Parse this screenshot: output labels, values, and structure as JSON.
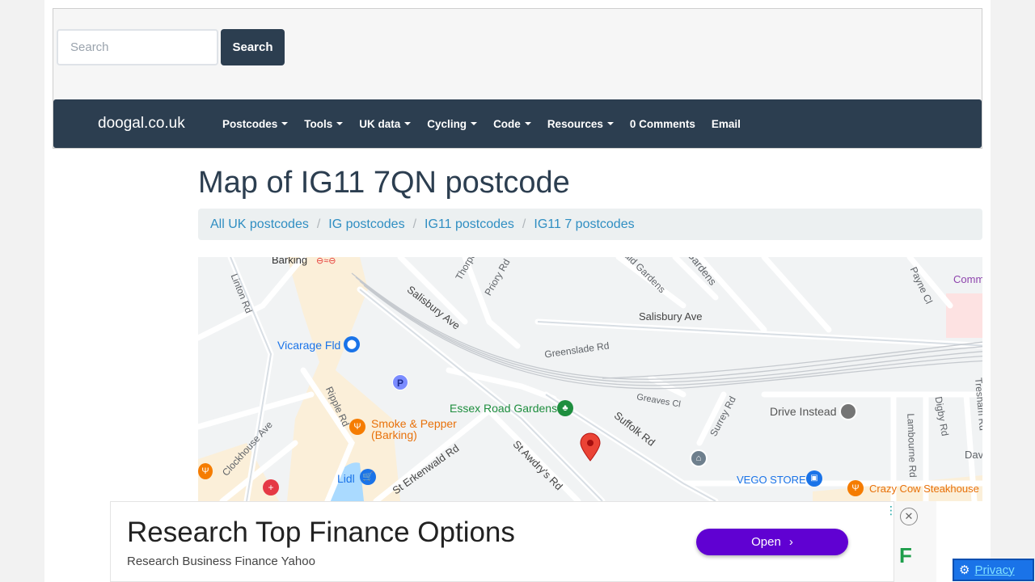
{
  "search": {
    "placeholder": "Search",
    "button_label": "Search"
  },
  "navbar": {
    "brand": "doogal.co.uk",
    "items": [
      {
        "label": "Postcodes",
        "dropdown": true
      },
      {
        "label": "Tools",
        "dropdown": true
      },
      {
        "label": "UK data",
        "dropdown": true
      },
      {
        "label": "Cycling",
        "dropdown": true
      },
      {
        "label": "Code",
        "dropdown": true
      },
      {
        "label": "Resources",
        "dropdown": true
      },
      {
        "label": "0 Comments",
        "dropdown": false
      },
      {
        "label": "Email",
        "dropdown": false
      }
    ]
  },
  "page_title": "Map of IG11 7QN postcode",
  "breadcrumb": [
    "All UK postcodes",
    "IG postcodes",
    "IG11 postcodes",
    "IG11 7 postcodes"
  ],
  "map": {
    "labels": {
      "barking": "Barking",
      "linton_rd": "Linton Rd",
      "salisbury_ave_1": "Salisbury Ave",
      "salisbury_ave_2": "Salisbury Ave",
      "thorpe": "Thorpe",
      "priory_rd": "Priory Rd",
      "gardens_1": "ald Gardens",
      "gardens_2": "Gardens",
      "payne_cl": "Payne Cl",
      "comm": "Comm",
      "vicarage_fld": "Vicarage Fld",
      "greenslade_rd": "Greenslade Rd",
      "essex_road_gardens": "Essex Road Gardens",
      "greaves_cl": "Greaves Cl",
      "surrey_rd": "Surrey Rd",
      "drive_instead": "Drive Instead",
      "digby_rd": "Digby Rd",
      "tresham_rd": "Tresham Rd",
      "ripple_rd": "Ripple Rd",
      "smoke_pepper": "Smoke & Pepper",
      "smoke_pepper_2": "(Barking)",
      "suffolk_rd": "Suffolk Rd",
      "lambourne_rd": "Lambourne Rd",
      "dav": "Dav",
      "clockhouse_ave": "Clockhouse Ave",
      "st_erkenwald_rd": "St Erkenwald Rd",
      "st_awdrys_rd": "St Awdry's Rd",
      "lidl": "Lidl",
      "vego_store": "VEGO STORE",
      "crazy_cow": "Crazy Cow Steakhouse",
      "parking": "P"
    },
    "colors": {
      "water": "#aadaff",
      "park_green": "#1e8e3e",
      "food_orange": "#f57c00",
      "shop_blue": "#1a73e8",
      "pin_red": "#ea4335",
      "poi_purple": "#8e44ad"
    }
  },
  "ad": {
    "title": "Research Top Finance Options",
    "subtitle": "Research Business Finance Yahoo",
    "open_label": "Open"
  },
  "privacy_label": "Privacy"
}
